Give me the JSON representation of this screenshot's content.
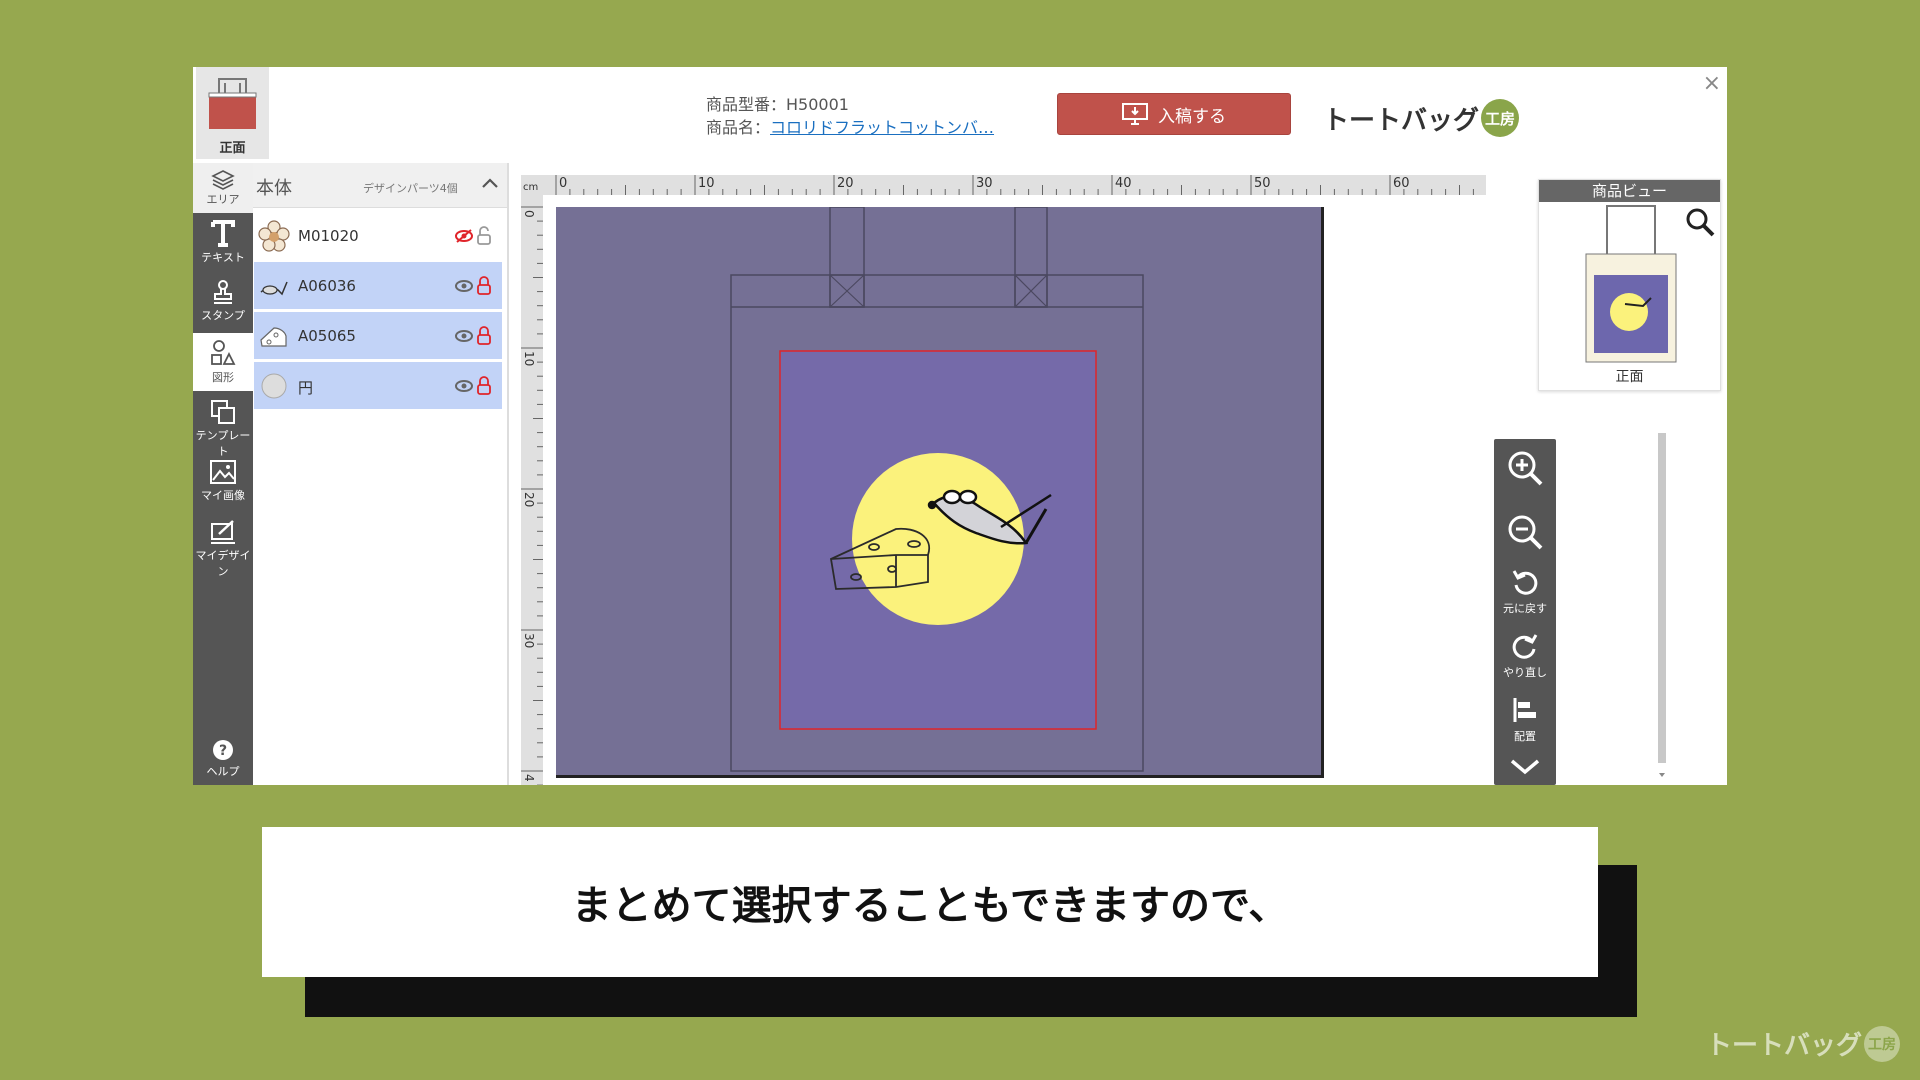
{
  "header": {
    "face_tab_label": "正面",
    "product_code": "商品型番：H50001",
    "product_name_label": "商品名：",
    "product_name_link": "コロリドフラットコットンバ…",
    "submit_label": "入稿する",
    "brand": "トートバッグ",
    "brand_badge": "工房",
    "close": "×"
  },
  "tools": [
    {
      "label": "エリア",
      "icon": "layers-icon"
    },
    {
      "label": "テキスト",
      "icon": "text-icon"
    },
    {
      "label": "スタンプ",
      "icon": "stamp-icon"
    },
    {
      "label": "図形",
      "icon": "shapes-icon"
    },
    {
      "label": "テンプレート",
      "icon": "template-icon"
    },
    {
      "label": "マイ画像",
      "icon": "image-icon"
    },
    {
      "label": "マイデザイン",
      "icon": "mydesign-icon"
    },
    {
      "label": "ヘルプ",
      "icon": "help-icon"
    }
  ],
  "layer_panel": {
    "title": "本体",
    "count": "デザインパーツ4個",
    "layers": [
      {
        "name": "M01020",
        "selected": false,
        "hidden": true
      },
      {
        "name": "A06036",
        "selected": true,
        "hidden": false
      },
      {
        "name": "A05065",
        "selected": true,
        "hidden": false
      },
      {
        "name": "円",
        "selected": true,
        "hidden": false
      }
    ]
  },
  "ruler": {
    "unit": "cm",
    "top_labels": [
      "0",
      "10",
      "20",
      "30",
      "40",
      "50",
      "60"
    ],
    "left_labels": [
      "0",
      "10",
      "20",
      "30",
      "4"
    ]
  },
  "preview": {
    "title": "商品ビュー",
    "face": "正面"
  },
  "zoom": {
    "undo": "元に戻す",
    "redo": "やり直し",
    "align": "配置"
  },
  "caption": "まとめて選択することもできますので、",
  "watermark": {
    "text": "トートバッグ",
    "badge": "工房"
  },
  "colors": {
    "background": "#96a84f",
    "accent": "#c0524b",
    "bag_color": "#757095",
    "print_area": "#756aa9",
    "moon": "#fbf27c",
    "selection": "#c2d3f7"
  }
}
